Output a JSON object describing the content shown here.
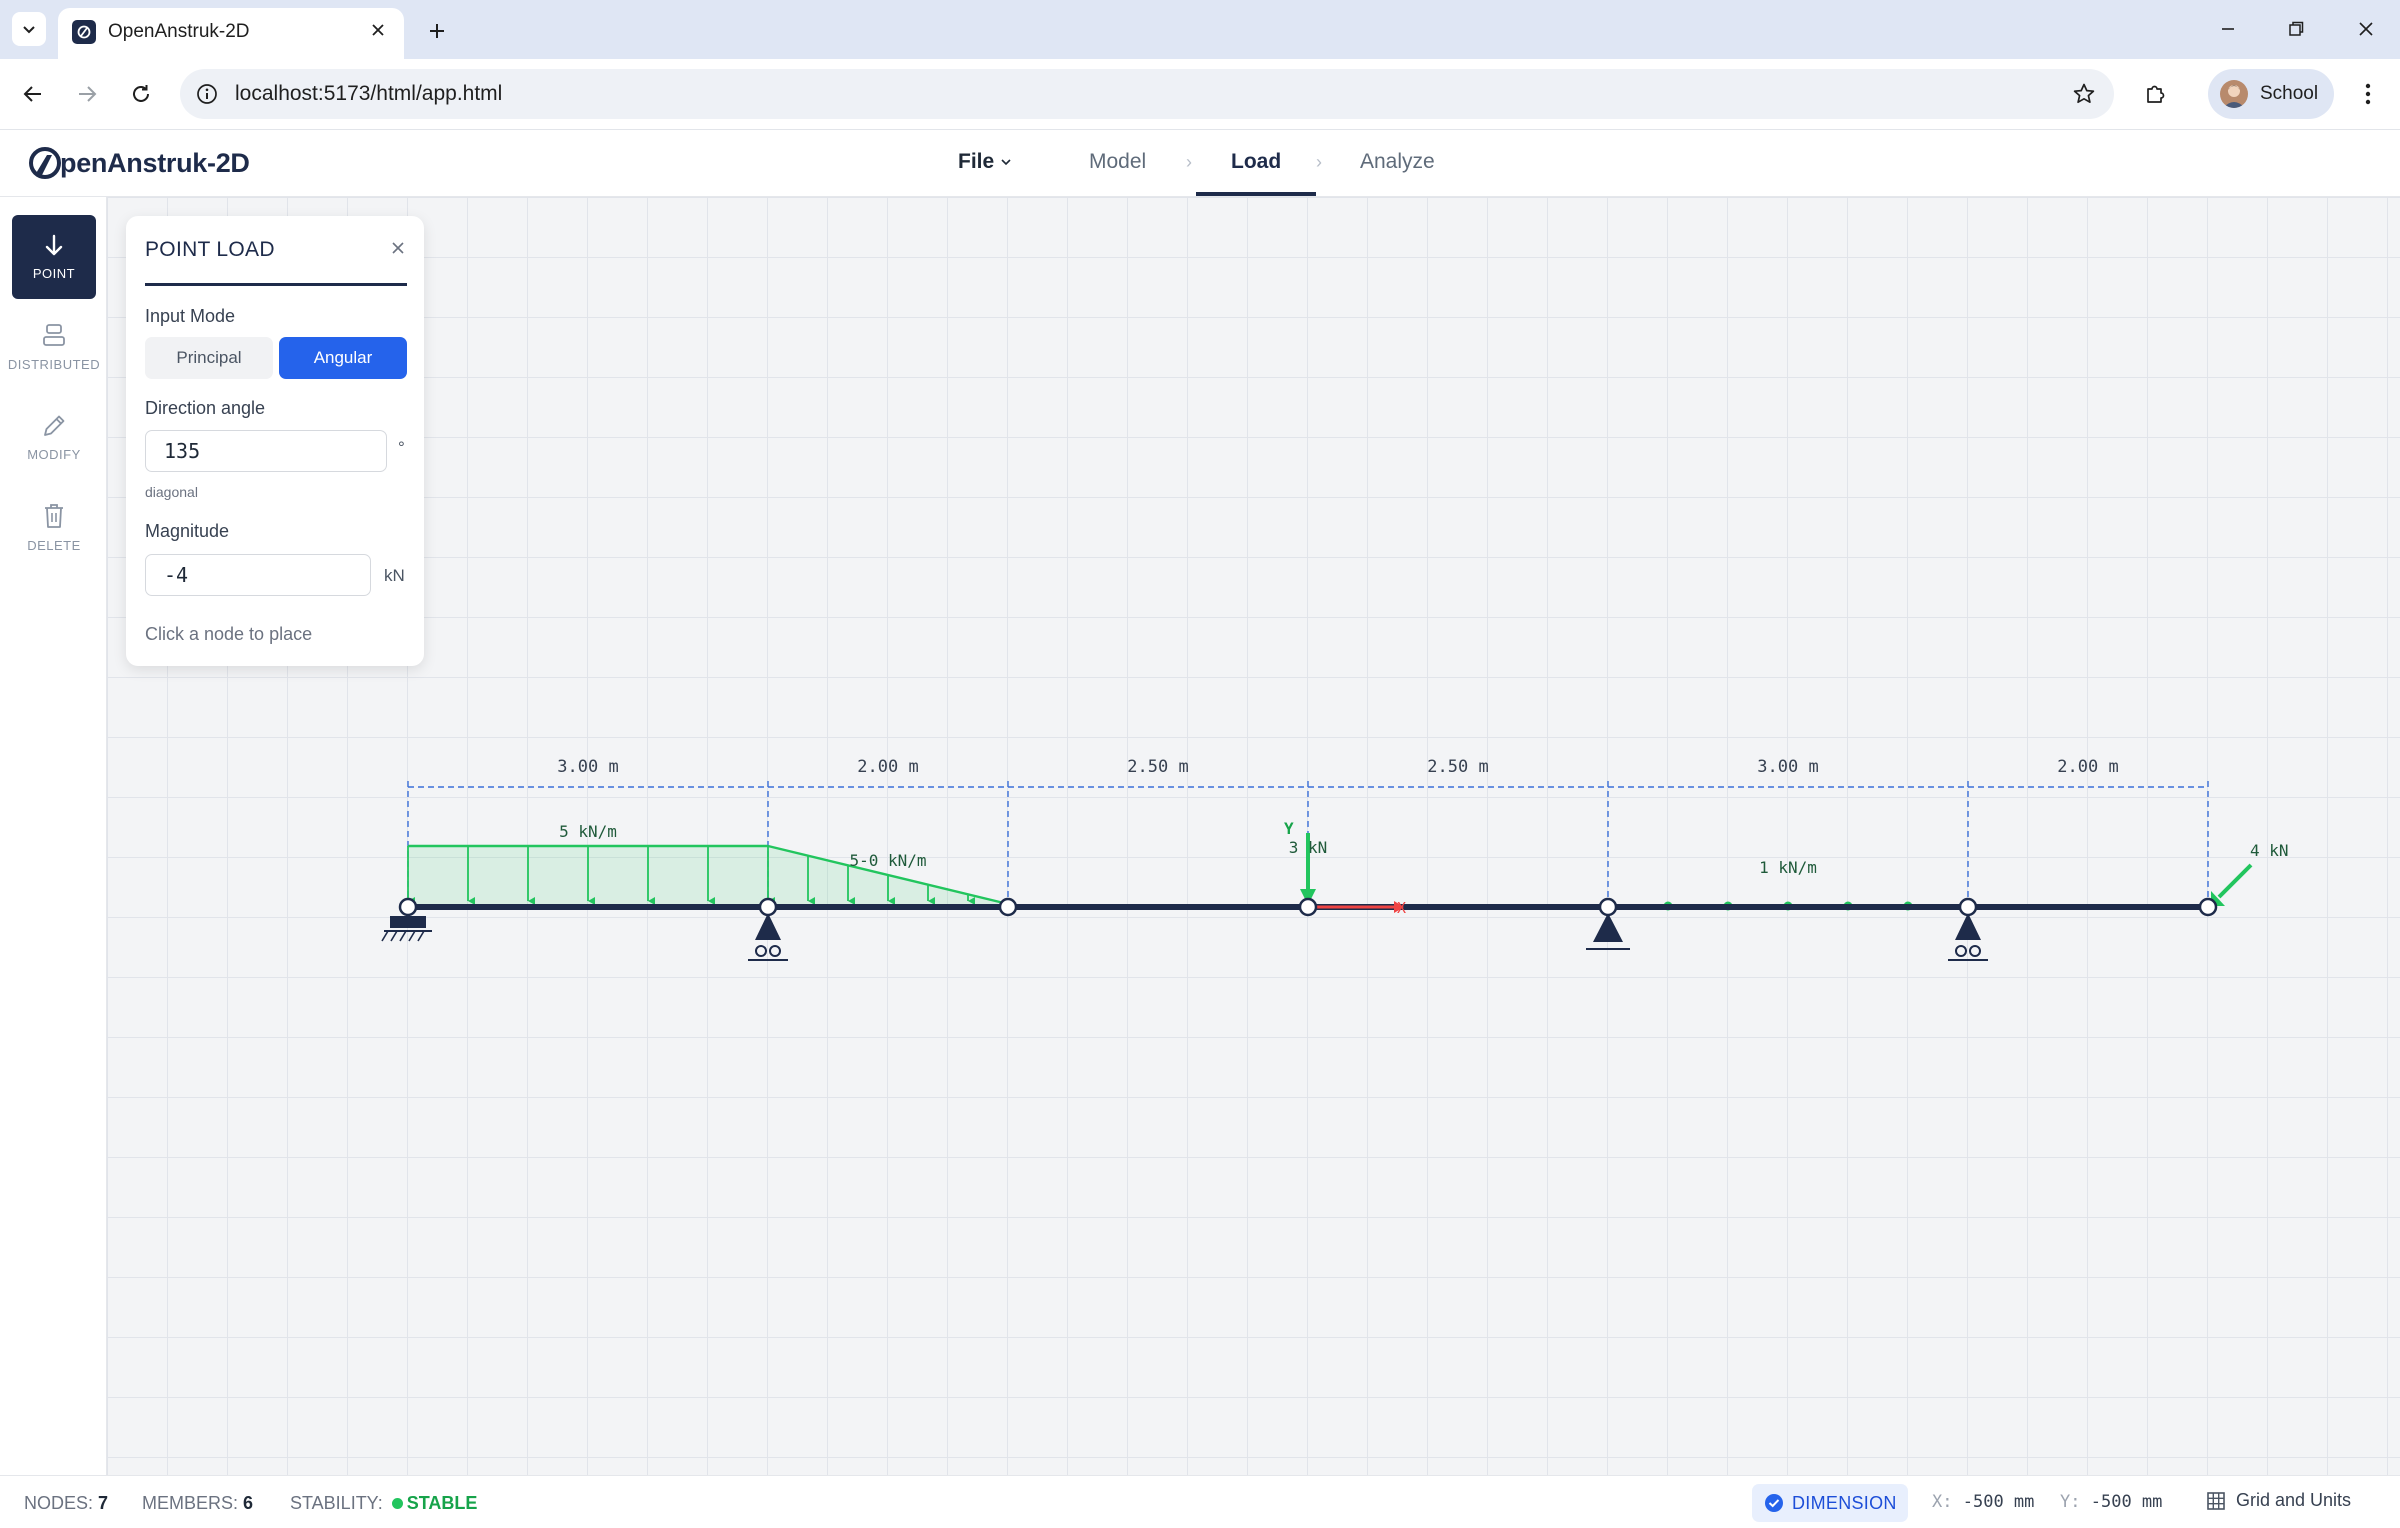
{
  "browser": {
    "tab_title": "OpenAnstruk-2D",
    "url": "localhost:5173/html/app.html",
    "profile_label": "School"
  },
  "app": {
    "logo_text": "penAnstruk-2D",
    "nav": {
      "file": "File",
      "model": "Model",
      "load": "Load",
      "analyze": "Analyze",
      "active": "Load"
    }
  },
  "toolbar": {
    "tools": [
      {
        "label": "POINT",
        "icon": "arrow-down-icon",
        "active": true
      },
      {
        "label": "DISTRIBUTED",
        "icon": "distributed-icon",
        "active": false
      },
      {
        "label": "MODIFY",
        "icon": "pencil-icon",
        "active": false
      },
      {
        "label": "DELETE",
        "icon": "trash-icon",
        "active": false
      }
    ]
  },
  "panel": {
    "title": "POINT LOAD",
    "input_mode_label": "Input Mode",
    "mode_principal": "Principal",
    "mode_angular": "Angular",
    "selected_mode": "Angular",
    "direction_label": "Direction angle",
    "direction_value": "135",
    "direction_unit": "°",
    "direction_hint": "diagonal",
    "magnitude_label": "Magnitude",
    "magnitude_value": "-4",
    "magnitude_unit": "kN",
    "footer_hint": "Click a node to place"
  },
  "structure": {
    "spans": [
      {
        "label": "3.00 m",
        "length": 3.0
      },
      {
        "label": "2.00 m",
        "length": 2.0
      },
      {
        "label": "2.50 m",
        "length": 2.5
      },
      {
        "label": "2.50 m",
        "length": 2.5
      },
      {
        "label": "3.00 m",
        "length": 3.0
      },
      {
        "label": "2.00 m",
        "length": 2.0
      }
    ],
    "supports": [
      {
        "node": 0,
        "type": "fixed"
      },
      {
        "node": 2,
        "type": "roller"
      },
      {
        "node": 4,
        "type": "pin"
      },
      {
        "node": 5,
        "type": "roller"
      }
    ],
    "loads": {
      "udl_label": "5 kN/m",
      "trap_label": "5-0 kN/m",
      "point_label": "3 kN",
      "axial_label": "1 kN/m",
      "angled_label": "4 kN",
      "axis_y": "Y",
      "axis_x": "X"
    }
  },
  "status": {
    "nodes_label": "NODES:",
    "nodes_value": "7",
    "members_label": "MEMBERS:",
    "members_value": "6",
    "stability_label": "STABILITY:",
    "stability_value": "STABLE",
    "dimension_label": "DIMENSION",
    "x_label": "X:",
    "x_value": "-500 mm",
    "y_label": "Y:",
    "y_value": "-500 mm",
    "grid_units_label": "Grid and Units"
  },
  "colors": {
    "navy": "#1e2b4a",
    "load_green": "#22c55e",
    "accent_blue": "#2563eb",
    "dimension_blue": "#3b6fd8",
    "axis_red": "#ef4444"
  }
}
